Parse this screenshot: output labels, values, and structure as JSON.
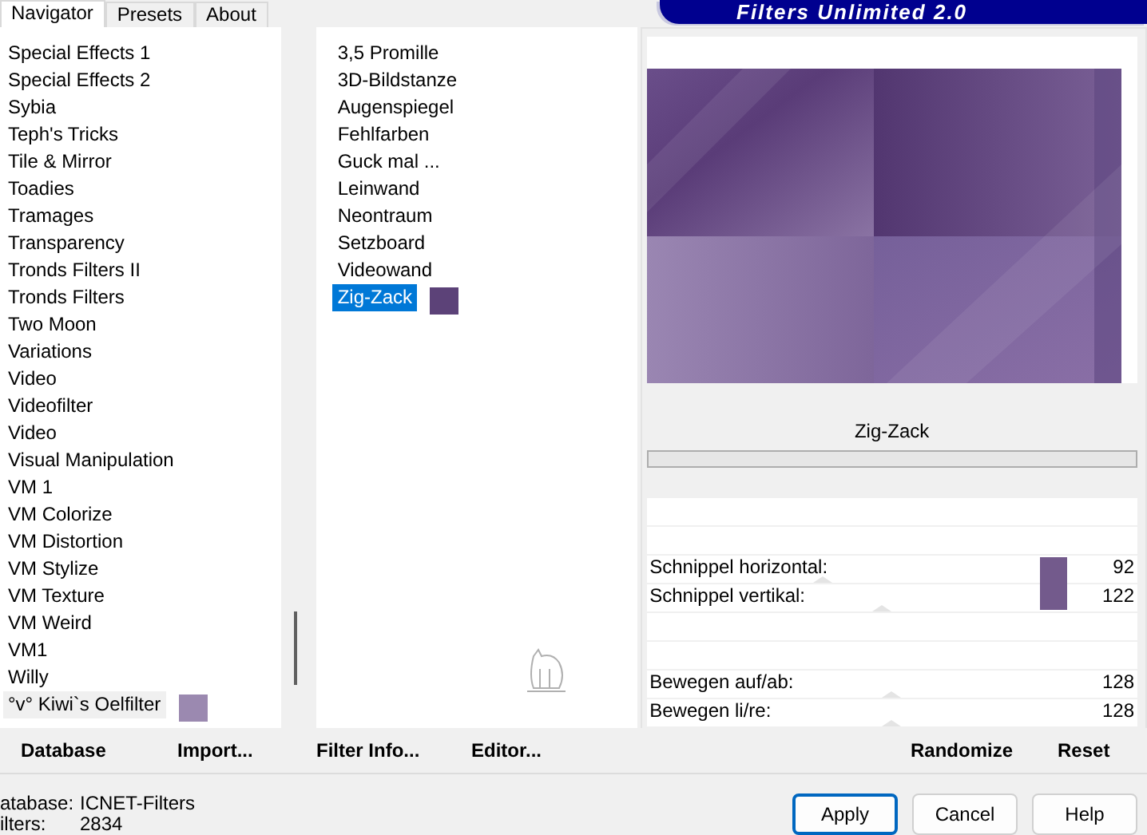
{
  "banner": {
    "title": "Filters Unlimited 2.0"
  },
  "tabs": [
    {
      "label": "Navigator",
      "selected": true
    },
    {
      "label": "Presets",
      "selected": false
    },
    {
      "label": "About",
      "selected": false
    }
  ],
  "categories": [
    {
      "label": "Special Effects 1",
      "selected": false
    },
    {
      "label": "Special Effects 2",
      "selected": false
    },
    {
      "label": "Sybia",
      "selected": false
    },
    {
      "label": "Teph's Tricks",
      "selected": false
    },
    {
      "label": "Tile & Mirror",
      "selected": false
    },
    {
      "label": "Toadies",
      "selected": false
    },
    {
      "label": "Tramages",
      "selected": false
    },
    {
      "label": "Transparency",
      "selected": false
    },
    {
      "label": "Tronds Filters II",
      "selected": false
    },
    {
      "label": "Tronds Filters",
      "selected": false
    },
    {
      "label": "Two Moon",
      "selected": false
    },
    {
      "label": "Variations",
      "selected": false
    },
    {
      "label": "Video",
      "selected": false
    },
    {
      "label": "Videofilter",
      "selected": false
    },
    {
      "label": "Video",
      "selected": false
    },
    {
      "label": "Visual Manipulation",
      "selected": false
    },
    {
      "label": "VM 1",
      "selected": false
    },
    {
      "label": "VM Colorize",
      "selected": false
    },
    {
      "label": "VM Distortion",
      "selected": false
    },
    {
      "label": "VM Stylize",
      "selected": false
    },
    {
      "label": "VM Texture",
      "selected": false
    },
    {
      "label": "VM Weird",
      "selected": false
    },
    {
      "label": "VM1",
      "selected": false
    },
    {
      "label": "Willy",
      "selected": false
    },
    {
      "label": "°v° Kiwi`s Oelfilter",
      "selected": true
    }
  ],
  "filters": [
    {
      "label": "3,5 Promille",
      "selected": false
    },
    {
      "label": "3D-Bildstanze",
      "selected": false
    },
    {
      "label": "Augenspiegel",
      "selected": false
    },
    {
      "label": "Fehlfarben",
      "selected": false
    },
    {
      "label": "Guck mal ...",
      "selected": false
    },
    {
      "label": "Leinwand",
      "selected": false
    },
    {
      "label": "Neontraum",
      "selected": false
    },
    {
      "label": "Setzboard",
      "selected": false
    },
    {
      "label": "Videowand",
      "selected": false
    },
    {
      "label": "Zig-Zack",
      "selected": true
    }
  ],
  "filter_name": "Zig-Zack",
  "controls": [
    {
      "kind": "empty"
    },
    {
      "kind": "empty"
    },
    {
      "kind": "slider",
      "label": "Schnippel horizontal:",
      "value": "92",
      "level": 0.36
    },
    {
      "kind": "slider",
      "label": "Schnippel vertikal:",
      "value": "122",
      "level": 0.48
    },
    {
      "kind": "empty"
    },
    {
      "kind": "empty"
    },
    {
      "kind": "slider",
      "label": "Bewegen auf/ab:",
      "value": "128",
      "level": 0.5
    },
    {
      "kind": "slider",
      "label": "Bewegen li/re:",
      "value": "128",
      "level": 0.5
    }
  ],
  "left_buttons": [
    "Database",
    "Import...",
    "Filter Info...",
    "Editor..."
  ],
  "right_buttons": [
    "Randomize",
    "Reset"
  ],
  "status": [
    {
      "label": "atabase:",
      "value": "ICNET-Filters"
    },
    {
      "label": "ilters:",
      "value": "2834"
    }
  ],
  "dialog_buttons": [
    {
      "label": "Apply",
      "default": true
    },
    {
      "label": "Cancel",
      "default": false
    },
    {
      "label": "Help",
      "default": false
    }
  ]
}
